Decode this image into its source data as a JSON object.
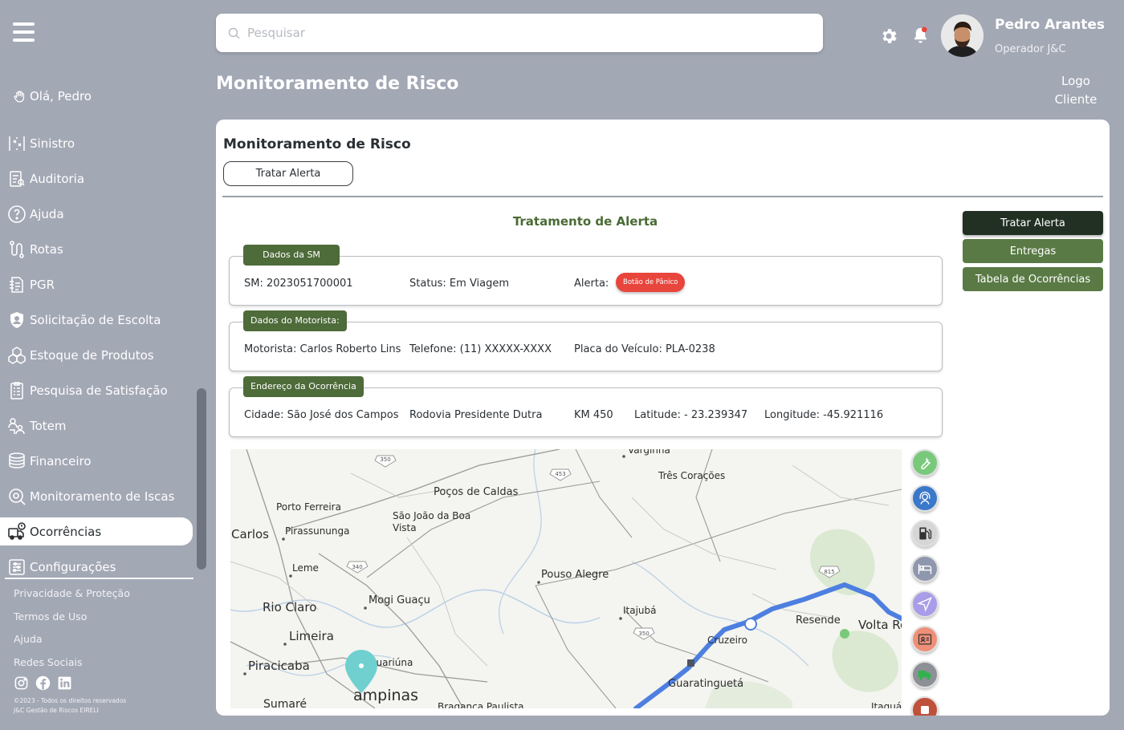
{
  "sidebar": {
    "greeting": "Olá, Pedro",
    "items": [
      {
        "label": "Sinistro",
        "icon": "accident-icon"
      },
      {
        "label": "Auditoria",
        "icon": "audit-icon"
      },
      {
        "label": "Ajuda",
        "icon": "help-icon"
      },
      {
        "label": "Rotas",
        "icon": "route-icon"
      },
      {
        "label": "PGR",
        "icon": "document-list-icon"
      },
      {
        "label": "Solicitação de Escolta",
        "icon": "shield-icon"
      },
      {
        "label": "Estoque de Produtos",
        "icon": "boxes-icon"
      },
      {
        "label": "Pesquisa de Satisfação",
        "icon": "survey-icon"
      },
      {
        "label": "Totem",
        "icon": "people-icon"
      },
      {
        "label": "Financeiro",
        "icon": "money-icon"
      },
      {
        "label": "Monitoramento de Iscas",
        "icon": "tracking-icon"
      },
      {
        "label": "Ocorrências",
        "icon": "truck-alert-icon",
        "active": true
      },
      {
        "label": "Configurações",
        "icon": "settings-sliders-icon"
      }
    ],
    "footer_links": [
      "Privacidade & Proteção",
      "Termos de Uso",
      "Ajuda",
      "Redes Sociais"
    ],
    "copyright_line1": "©2023 - Todos os direitos reservados",
    "copyright_line2": "J&C Gestão de Riscos EIRELI"
  },
  "header": {
    "search_placeholder": "Pesquisar",
    "user_name": "Pedro Arantes",
    "user_role": "Operador J&C",
    "page_title": "Monitoramento de Risco",
    "logo_line1": "Logo",
    "logo_line2": "Cliente"
  },
  "card": {
    "title": "Monitoramento de Risco",
    "tratar_button": "Tratar Alerta",
    "section_title": "Tratamento de Alerta",
    "dados_sm": {
      "tag": "Dados da SM",
      "sm": "SM: 2023051700001",
      "status": "Status: Em Viagem",
      "alert_label": "Alerta:",
      "alert_badge": "Botão de Pânico"
    },
    "dados_motorista": {
      "tag": "Dados do Motorista:",
      "motorista": "Motorista: Carlos Roberto Lins",
      "telefone": "Telefone: (11) XXXXX-XXXX",
      "placa": "Placa do Veículo: PLA-0238"
    },
    "endereco": {
      "tag": "Endereço da Ocorrência",
      "cidade": "Cidade: São José dos Campos",
      "rodovia": "Rodovia Presidente Dutra",
      "km": "KM 450",
      "latitude": "Latitude: - 23.239347",
      "longitude": "Longitude: -45.921116"
    },
    "side_buttons": [
      "Tratar Alerta",
      "Entregas",
      "Tabela de Ocorrências"
    ]
  },
  "map": {
    "places": {
      "varginha": "Varginha",
      "tres_coracoes": "Três Corações",
      "pocos": "Poços de Caldas",
      "porto_ferreira": "Porto Ferreira",
      "sao_joao_1": "São João da Boa",
      "sao_joao_2": "Vista",
      "carlos": "Carlos",
      "pirassununga": "Pirassununga",
      "leme": "Leme",
      "pouso_alegre": "Pouso Alegre",
      "rio_claro": "Rio Claro",
      "mogi_guacu": "Mogi Guaçu",
      "itajuba": "Itajubá",
      "resende": "Resende",
      "volta_redonda": "Volta Re",
      "limeira": "Limeira",
      "cruzeiro": "Cruzeiro",
      "piracicaba": "Piracicaba",
      "jaguariuna": "Jaguariúna",
      "guaratingueta": "Guaratinguetá",
      "campinas": "ampinas",
      "sumare": "Sumaré",
      "braganca": "Bragança Paulista",
      "itaqua": "Itaquá"
    },
    "road_shields": [
      "350",
      "453",
      "340",
      "815",
      "350"
    ],
    "colors": {
      "route": "#4d7fe0",
      "pin": "#6fd0cf"
    }
  },
  "map_tools": [
    {
      "icon": "wrench-icon",
      "color": "#79c97b"
    },
    {
      "icon": "support-agent-icon",
      "color": "#3a78c9"
    },
    {
      "icon": "fuel-pump-icon",
      "color": "#d6d6d6"
    },
    {
      "icon": "bed-icon",
      "color": "#8e97ad"
    },
    {
      "icon": "navigation-icon",
      "color": "#a99ce8"
    },
    {
      "icon": "id-card-icon",
      "color": "#ef8f78"
    },
    {
      "icon": "delivery-truck-icon",
      "color": "#8d9096"
    },
    {
      "icon": "extra-tool-icon",
      "color": "#c0503a"
    }
  ]
}
